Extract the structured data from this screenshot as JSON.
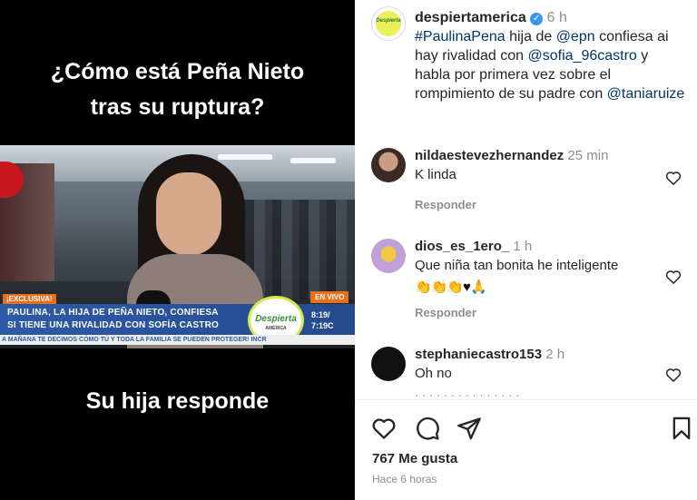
{
  "media": {
    "headline_line1": "¿Cómo está Peña Nieto",
    "headline_line2": "tras su ruptura?",
    "caption": "Su hija responde",
    "video": {
      "badge_exclusive": "¡EXCLUSIVA!",
      "badge_live": "EN VIVO",
      "lower_third_line1": "PAULINA, LA HIJA DE PEÑA NIETO, CONFIESA",
      "lower_third_line2": "SI TIENE UNA RIVALIDAD CON SOFÍA CASTRO",
      "logo_text": "Despierta",
      "logo_sub": "AMÉRICA",
      "clock_line1": "8:19/",
      "clock_line2": "7:19C",
      "ticker": "A MAÑANA TE DECIMOS CÓMO TÚ Y TODA LA FAMILIA SE PUEDEN PROTEGER! INCR"
    }
  },
  "post": {
    "author": {
      "avatar_text": "Despierta",
      "username": "despiertamerica",
      "verified_glyph": "✓",
      "time": "6 h"
    },
    "caption": {
      "hashtag": "#PaulinaPena",
      "t1": " hija de ",
      "mention1": "@epn",
      "t2": " confiesa ai hay rivalidad con ",
      "mention2": "@sofia_96castro",
      "t3": " y habla por primera vez sobre el rompimiento de su padre con ",
      "mention3": "@taniaruize"
    },
    "comments": [
      {
        "username": "nildaestevezhernandez",
        "time": "25 min",
        "text": "K linda",
        "reply_label": "Responder"
      },
      {
        "username": "dios_es_1ero_",
        "time": "1 h",
        "text": "Que niña tan bonita he inteligente",
        "emoji": "👏👏👏",
        "emoji_tail": "♥🙏",
        "reply_label": "Responder"
      },
      {
        "username": "stephaniecastro153",
        "time": "2 h",
        "text": "Oh no"
      }
    ],
    "partial_row": "· · · · · · ·   · · · · · · · ·",
    "likes": "767 Me gusta",
    "posted": "Hace 6 horas"
  },
  "icons": {
    "like": "heart-icon",
    "comment": "comment-icon",
    "share": "paper-plane-icon",
    "save": "bookmark-icon"
  },
  "colors": {
    "link": "#00376b",
    "muted": "#8e8e8e",
    "verified": "#3897f0",
    "lower_third": "#2d5aa8",
    "badge": "#e8701a"
  }
}
